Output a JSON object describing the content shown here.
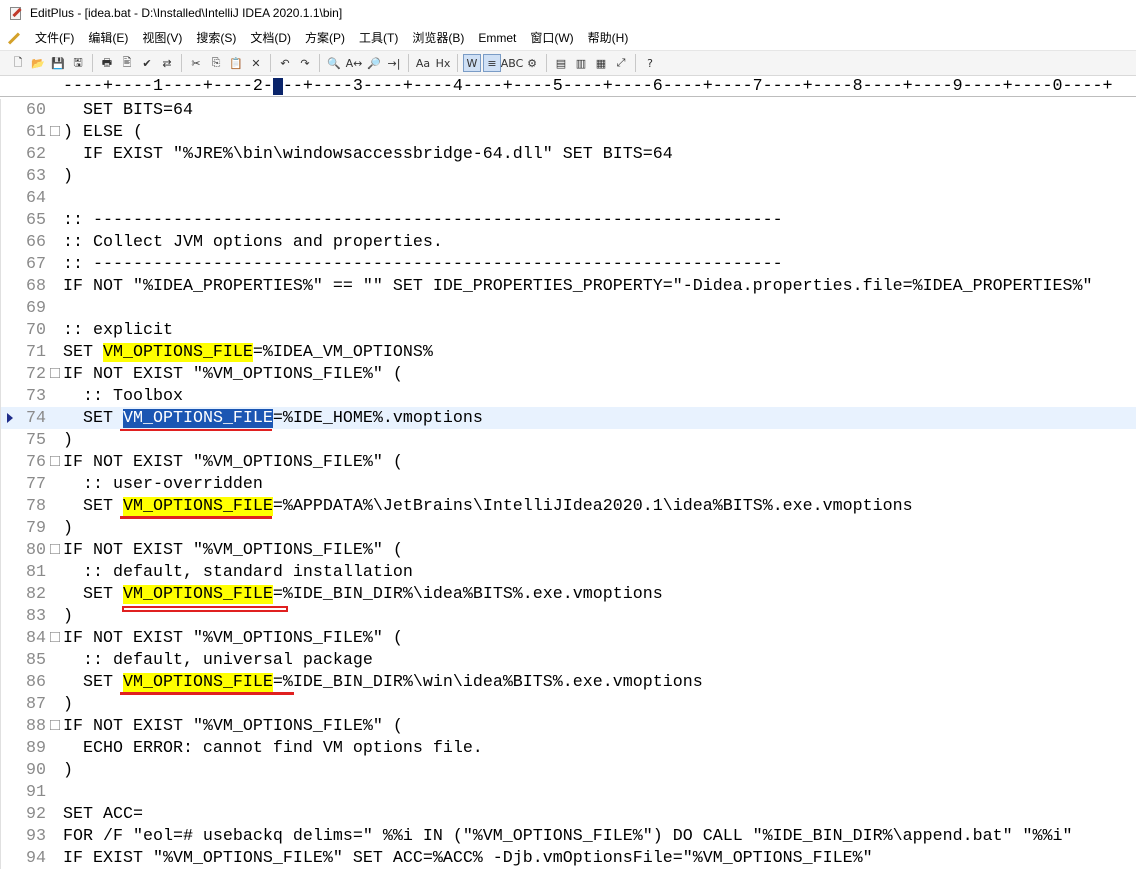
{
  "window": {
    "title": "EditPlus - [idea.bat - D:\\Installed\\IntelliJ IDEA 2020.1.1\\bin]"
  },
  "menu": [
    "文件(F)",
    "编辑(E)",
    "视图(V)",
    "搜索(S)",
    "文档(D)",
    "方案(P)",
    "工具(T)",
    "浏览器(B)",
    "Emmet",
    "窗口(W)",
    "帮助(H)"
  ],
  "ruler": {
    "text": "----+----1----+----2----+----3----+----4----+----5----+----6----+----7----+----8----+----9----+----0----+"
  },
  "toolbar": {
    "icons": [
      "new-file-icon",
      "open-folder-icon",
      "save-icon",
      "save-all-icon",
      "print-icon",
      "print-preview-icon",
      "spell-check-icon",
      "replace-icon",
      "cut-icon",
      "copy-icon",
      "paste-icon",
      "delete-icon",
      "undo-icon",
      "redo-icon",
      "find-icon",
      "find-replace-icon",
      "find-in-files-icon",
      "goto-line-icon",
      "font-icon",
      "hex-icon",
      "word-wrap-icon",
      "line-numbers-icon",
      "column-select-icon",
      "settings-icon",
      "window-list-icon",
      "document-selector-icon",
      "browser-icon",
      "fullscreen-icon",
      "help-icon"
    ],
    "glyphs": [
      "🗋",
      "📂",
      "💾",
      "🖫",
      "🖶",
      "🖹",
      "✔",
      "⇄",
      "✂",
      "⎘",
      "📋",
      "✕",
      "↶",
      "↷",
      "🔍",
      "A↔",
      "🔎",
      "→|",
      "Aa",
      "Hx",
      "W",
      "≡",
      "ABC",
      "⚙",
      "▤",
      "▥",
      "▦",
      "⤢",
      "?"
    ]
  },
  "editor": {
    "current_line": 74,
    "lines": [
      {
        "num": "60",
        "fold": "",
        "parts": [
          {
            "t": "  SET BITS=64"
          }
        ]
      },
      {
        "num": "61",
        "fold": "□",
        "parts": [
          {
            "t": ") ELSE ("
          }
        ]
      },
      {
        "num": "62",
        "fold": "",
        "parts": [
          {
            "t": "  IF EXIST \"%JRE%\\bin\\windowsaccessbridge-64.dll\" SET BITS=64"
          }
        ]
      },
      {
        "num": "63",
        "fold": "",
        "parts": [
          {
            "t": ")"
          }
        ]
      },
      {
        "num": "64",
        "fold": "",
        "parts": [
          {
            "t": ""
          }
        ]
      },
      {
        "num": "65",
        "fold": "",
        "parts": [
          {
            "t": ":: ---------------------------------------------------------------------"
          }
        ]
      },
      {
        "num": "66",
        "fold": "",
        "parts": [
          {
            "t": ":: Collect JVM options and properties."
          }
        ]
      },
      {
        "num": "67",
        "fold": "",
        "parts": [
          {
            "t": ":: ---------------------------------------------------------------------"
          }
        ]
      },
      {
        "num": "68",
        "fold": "",
        "parts": [
          {
            "t": "IF NOT \"%IDEA_PROPERTIES%\" == \"\" SET IDE_PROPERTIES_PROPERTY=\"-Didea.properties.file=%IDEA_PROPERTIES%\""
          }
        ]
      },
      {
        "num": "69",
        "fold": "",
        "parts": [
          {
            "t": ""
          }
        ]
      },
      {
        "num": "70",
        "fold": "",
        "parts": [
          {
            "t": ":: explicit"
          }
        ]
      },
      {
        "num": "71",
        "fold": "",
        "parts": [
          {
            "t": "SET "
          },
          {
            "t": "VM_OPTIONS_FILE",
            "c": "hl"
          },
          {
            "t": "=%IDEA_VM_OPTIONS%"
          }
        ]
      },
      {
        "num": "72",
        "fold": "□",
        "parts": [
          {
            "t": "IF NOT EXIST \"%VM_OPTIONS_FILE%\" ("
          }
        ]
      },
      {
        "num": "73",
        "fold": "",
        "parts": [
          {
            "t": "  :: Toolbox"
          }
        ]
      },
      {
        "num": "74",
        "fold": "",
        "parts": [
          {
            "t": "  SET "
          },
          {
            "t": "VM_OPTIONS_FILE",
            "c": "sel"
          },
          {
            "t": "=%IDE_HOME%.vmoptions"
          }
        ]
      },
      {
        "num": "75",
        "fold": "",
        "parts": [
          {
            "t": ")"
          }
        ]
      },
      {
        "num": "76",
        "fold": "□",
        "parts": [
          {
            "t": "IF NOT EXIST \"%VM_OPTIONS_FILE%\" ("
          }
        ]
      },
      {
        "num": "77",
        "fold": "",
        "parts": [
          {
            "t": "  :: user-overridden"
          }
        ]
      },
      {
        "num": "78",
        "fold": "",
        "parts": [
          {
            "t": "  SET "
          },
          {
            "t": "VM_OPTIONS_FILE",
            "c": "hl"
          },
          {
            "t": "=%APPDATA%\\JetBrains\\IntelliJIdea2020.1\\idea%BITS%.exe.vmoptions"
          }
        ]
      },
      {
        "num": "79",
        "fold": "",
        "parts": [
          {
            "t": ")"
          }
        ]
      },
      {
        "num": "80",
        "fold": "□",
        "parts": [
          {
            "t": "IF NOT EXIST \"%VM_OPTIONS_FILE%\" ("
          }
        ]
      },
      {
        "num": "81",
        "fold": "",
        "parts": [
          {
            "t": "  :: default, standard installation"
          }
        ]
      },
      {
        "num": "82",
        "fold": "",
        "parts": [
          {
            "t": "  SET "
          },
          {
            "t": "VM_OPTIONS_FILE",
            "c": "hl"
          },
          {
            "t": "=%IDE_BIN_DIR%\\idea%BITS%.exe.vmoptions"
          }
        ]
      },
      {
        "num": "83",
        "fold": "",
        "parts": [
          {
            "t": ")"
          }
        ]
      },
      {
        "num": "84",
        "fold": "□",
        "parts": [
          {
            "t": "IF NOT EXIST \"%VM_OPTIONS_FILE%\" ("
          }
        ]
      },
      {
        "num": "85",
        "fold": "",
        "parts": [
          {
            "t": "  :: default, universal package"
          }
        ]
      },
      {
        "num": "86",
        "fold": "",
        "parts": [
          {
            "t": "  SET "
          },
          {
            "t": "VM_OPTIONS_FILE",
            "c": "hl"
          },
          {
            "t": "=%IDE_BIN_DIR%\\win\\idea%BITS%.exe.vmoptions"
          }
        ]
      },
      {
        "num": "87",
        "fold": "",
        "parts": [
          {
            "t": ")"
          }
        ]
      },
      {
        "num": "88",
        "fold": "□",
        "parts": [
          {
            "t": "IF NOT EXIST \"%VM_OPTIONS_FILE%\" ("
          }
        ]
      },
      {
        "num": "89",
        "fold": "",
        "parts": [
          {
            "t": "  ECHO ERROR: cannot find VM options file."
          }
        ]
      },
      {
        "num": "90",
        "fold": "",
        "parts": [
          {
            "t": ")"
          }
        ]
      },
      {
        "num": "91",
        "fold": "",
        "parts": [
          {
            "t": ""
          }
        ]
      },
      {
        "num": "92",
        "fold": "",
        "parts": [
          {
            "t": "SET ACC="
          }
        ]
      },
      {
        "num": "93",
        "fold": "",
        "parts": [
          {
            "t": "FOR /F \"eol=# usebackq delims=\" %%i IN (\"%VM_OPTIONS_FILE%\") DO CALL \"%IDE_BIN_DIR%\\append.bat\" \"%%i\""
          }
        ]
      },
      {
        "num": "94",
        "fold": "",
        "parts": [
          {
            "t": "IF EXIST \"%VM_OPTIONS_FILE%\" SET ACC=%ACC% -Djb.vmOptionsFile=\"%VM_OPTIONS_FILE%\""
          }
        ]
      }
    ]
  },
  "annotation_colors": {
    "underline": "#e02020",
    "highlight": "#ffff00",
    "selection": "#1b56b3"
  }
}
